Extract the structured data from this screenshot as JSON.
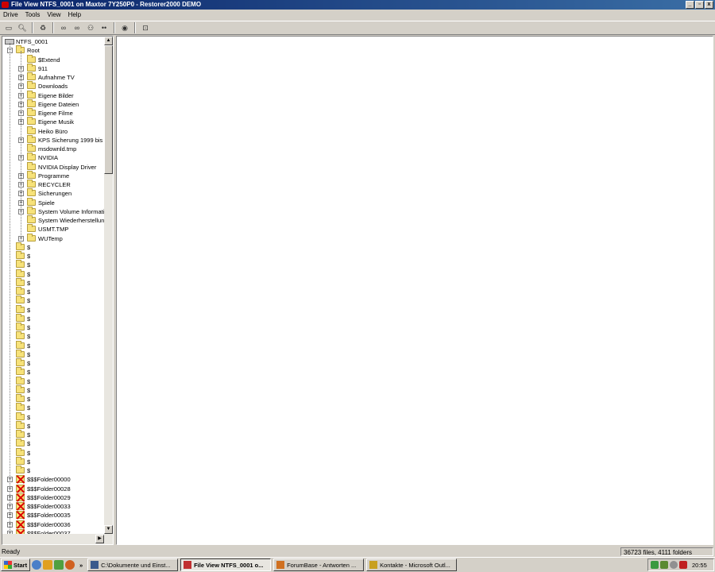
{
  "window": {
    "title": "File View NTFS_0001 on Maxtor 7Y250P0 - Restorer2000 DEMO",
    "controls": [
      "_",
      "▫",
      "x"
    ]
  },
  "menu": [
    "Drive",
    "Tools",
    "View",
    "Help"
  ],
  "toolbar": {
    "buttons": [
      "drive-icon",
      "find-icon",
      "recover-icon",
      "binoculars-icon",
      "find-next-icon",
      "mask-icon",
      "dots-icon",
      "globe-icon",
      "folder-up-icon"
    ]
  },
  "tree": {
    "drive": "NTFS_0001",
    "root": "Root",
    "root_children": [
      {
        "label": "$Extend",
        "expandable": false
      },
      {
        "label": "911",
        "expandable": true
      },
      {
        "label": "Aufnahme TV",
        "expandable": true
      },
      {
        "label": "Downloads",
        "expandable": true
      },
      {
        "label": "Eigene Bilder",
        "expandable": true
      },
      {
        "label": "Eigene Dateien",
        "expandable": true
      },
      {
        "label": "Eigene Filme",
        "expandable": true
      },
      {
        "label": "Eigene Musik",
        "expandable": true
      },
      {
        "label": "Heiko Büro",
        "expandable": false
      },
      {
        "label": "KPS Sicherung 1999 bis 2",
        "expandable": true
      },
      {
        "label": "msdownld.tmp",
        "expandable": false
      },
      {
        "label": "NVIDIA",
        "expandable": true
      },
      {
        "label": "NVIDIA Display Driver",
        "expandable": false
      },
      {
        "label": "Programme",
        "expandable": true
      },
      {
        "label": "RECYCLER",
        "expandable": true
      },
      {
        "label": "Sicherungen",
        "expandable": true
      },
      {
        "label": "Spiele",
        "expandable": true
      },
      {
        "label": "System Volume Informati",
        "expandable": true
      },
      {
        "label": "System Wiederherstellun",
        "expandable": false
      },
      {
        "label": "USMT.TMP",
        "expandable": false
      },
      {
        "label": "WUTemp",
        "expandable": true
      }
    ],
    "dollar_items": [
      "$",
      "$",
      "$",
      "$",
      "$",
      "$",
      "$",
      "$",
      "$",
      "$",
      "$",
      "$",
      "$",
      "$",
      "$",
      "$",
      "$",
      "$",
      "$",
      "$",
      "$",
      "$",
      "$",
      "$",
      "$",
      "$"
    ],
    "lost_folders": [
      "$$$Folder00000",
      "$$$Folder00028",
      "$$$Folder00029",
      "$$$Folder00033",
      "$$$Folder00035",
      "$$$Folder00036",
      "$$$Folder00037"
    ]
  },
  "status": {
    "left": "Ready",
    "right": "36723 files, 4111 folders"
  },
  "taskbar": {
    "start": "Start",
    "overflow": "»",
    "tasks": [
      {
        "label": "C:\\Dokumente und Einst...",
        "active": false,
        "icon_color": "#3a5a8c"
      },
      {
        "label": "File View NTFS_0001 o...",
        "active": true,
        "icon_color": "#c03030"
      },
      {
        "label": "ForumBase - Antworten ...",
        "active": false,
        "icon_color": "#d07020"
      },
      {
        "label": "Kontakte - Microsoft Outl...",
        "active": false,
        "icon_color": "#c8a020"
      }
    ],
    "clock": "20:55"
  },
  "colors": {
    "title_bar": "#0a246a",
    "window_face": "#d4d0c8",
    "folder": "#f7e27a",
    "lost_folder_mark": "#d00000"
  }
}
